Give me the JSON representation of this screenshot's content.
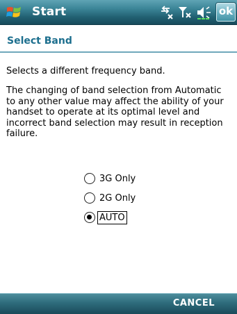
{
  "taskbar": {
    "start_label": "Start",
    "ok_label": "ok"
  },
  "header": {
    "title": "Select Band"
  },
  "content": {
    "description": "Selects a different frequency band.",
    "warning": "The changing of band selection from Automatic to any other value may affect the ability of your handset to operate at its optimal level and incorrect band selection may result in reception failure."
  },
  "options": [
    {
      "label": "3G Only",
      "selected": false
    },
    {
      "label": "2G Only",
      "selected": false
    },
    {
      "label": "AUTO",
      "selected": true
    }
  ],
  "menubar": {
    "right_softkey": "CANCEL"
  },
  "colors": {
    "accent_title": "#1d6f8e",
    "taskbar_dark": "#16495a"
  },
  "icons": [
    "windows-flag-icon",
    "connectivity-icon",
    "signal-icon",
    "volume-icon"
  ]
}
